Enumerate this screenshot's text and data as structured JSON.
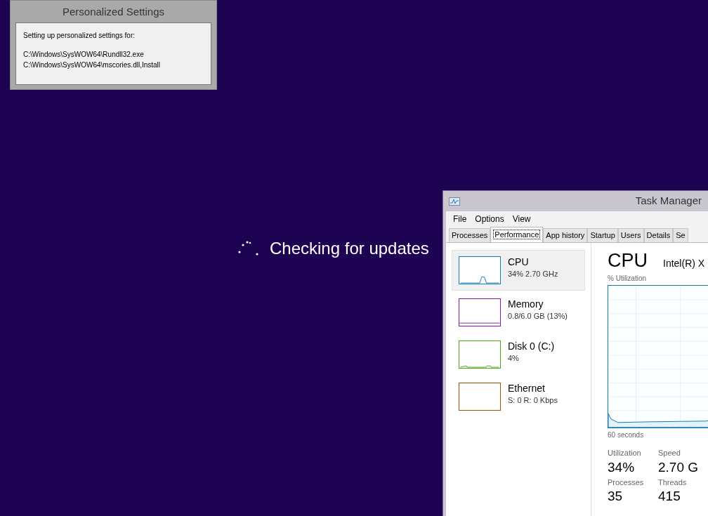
{
  "settings_window": {
    "title": "Personalized Settings",
    "message": "Setting up personalized settings for:",
    "paths": [
      "C:\\Windows\\SysWOW64\\Rundll32.exe",
      "C:\\Windows\\SysWOW64\\mscories.dll,Install"
    ]
  },
  "status": {
    "text": "Checking for updates"
  },
  "task_manager": {
    "title": "Task Manager",
    "menu": [
      "File",
      "Options",
      "View"
    ],
    "tabs": [
      {
        "label": "Processes",
        "selected": false
      },
      {
        "label": "Performance",
        "selected": true
      },
      {
        "label": "App history",
        "selected": false
      },
      {
        "label": "Startup",
        "selected": false
      },
      {
        "label": "Users",
        "selected": false
      },
      {
        "label": "Details",
        "selected": false
      },
      {
        "label": "Se",
        "selected": false
      }
    ],
    "resources": [
      {
        "name": "CPU",
        "detail": "34% 2.70 GHz",
        "selected": true,
        "color": "#117dbb"
      },
      {
        "name": "Memory",
        "detail": "0.8/6.0 GB (13%)",
        "selected": false,
        "color": "#8b12ae"
      },
      {
        "name": "Disk 0 (C:)",
        "detail": "4%",
        "selected": false,
        "color": "#4da60c"
      },
      {
        "name": "Ethernet",
        "detail": "S: 0 R: 0 Kbps",
        "selected": false,
        "color": "#a74f01"
      }
    ],
    "detail": {
      "heading": "CPU",
      "processor": "Intel(R) X",
      "graph_label": "% Utilization",
      "time_label": "60 seconds",
      "stats": [
        {
          "label": "Utilization",
          "value": "34%"
        },
        {
          "label": "Speed",
          "value": "2.70 G"
        },
        {
          "label": "Processes",
          "value": "35"
        },
        {
          "label": "Threads",
          "value": "415"
        }
      ]
    }
  }
}
